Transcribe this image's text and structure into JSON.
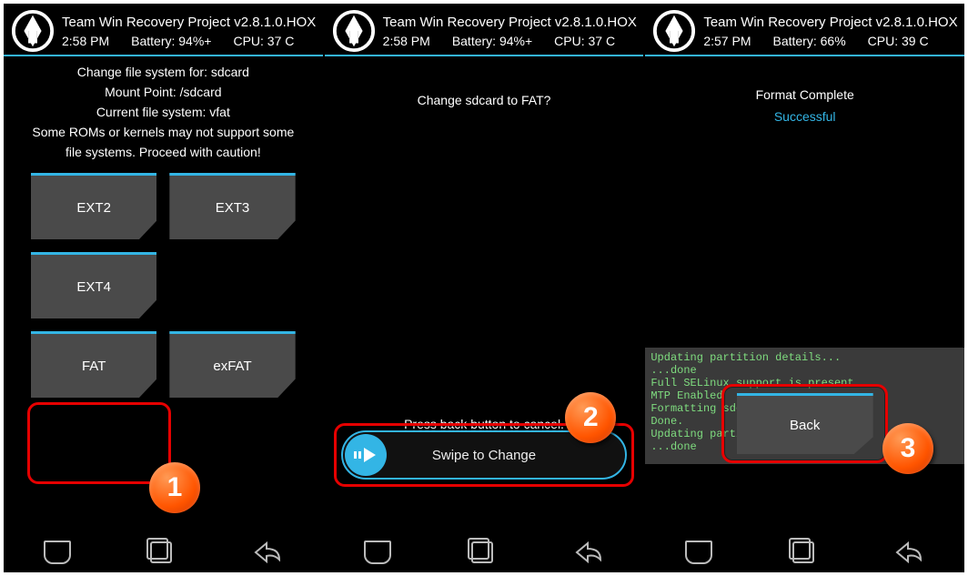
{
  "screens": [
    {
      "header": {
        "title": "Team Win Recovery Project  v2.8.1.0.HOX",
        "time": "2:58 PM",
        "battery": "Battery: 94%+",
        "cpu": "CPU: 37 C"
      },
      "info": {
        "l1": "Change file system for: sdcard",
        "l2": "Mount Point: /sdcard",
        "l3": "Current file system: vfat",
        "l4": "Some ROMs or kernels may not support some",
        "l5": "file systems. Proceed with caution!"
      },
      "buttons": {
        "ext2": "EXT2",
        "ext3": "EXT3",
        "ext4": "EXT4",
        "fat": "FAT",
        "exfat": "exFAT"
      }
    },
    {
      "header": {
        "title": "Team Win Recovery Project  v2.8.1.0.HOX",
        "time": "2:58 PM",
        "battery": "Battery: 94%+",
        "cpu": "CPU: 37 C"
      },
      "question": "Change sdcard to FAT?",
      "pressBack": "Press back button to cancel.",
      "swipeLabel": "Swipe to Change"
    },
    {
      "header": {
        "title": "Team Win Recovery Project  v2.8.1.0.HOX",
        "time": "2:57 PM",
        "battery": "Battery: 66%",
        "cpu": "CPU: 39 C"
      },
      "resultTitle": "Format Complete",
      "resultStatus": "Successful",
      "log": "Updating partition details...\n...done\nFull SELinux support is present.\nMTP Enabled\nFormatting sdcard using mkdosfs...\nDone.\nUpdating partition details...\n...done",
      "backLabel": "Back"
    }
  ],
  "callouts": {
    "c1": "1",
    "c2": "2",
    "c3": "3"
  }
}
